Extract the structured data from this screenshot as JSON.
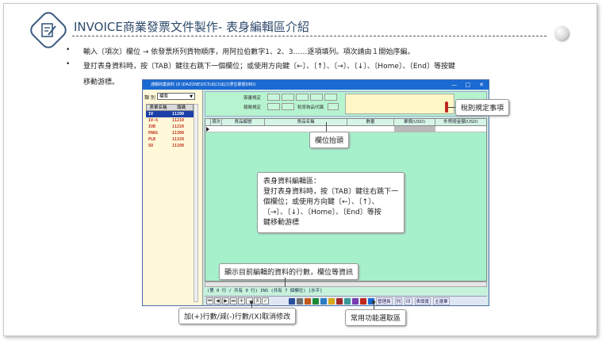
{
  "slide": {
    "title": "INVOICE商業發票文件製作- 表身編輯區介紹",
    "bullets": [
      "輸入〔項次〕欄位 → 依發票所列貨物順序，用阿拉伯數字1、2、3……逐項填列。項次請由１開始序編。",
      "登打表身資料時，按〔TAB〕鍵往右跳下一個欄位；或使用方向鍵〔←〕、〔↑〕、〔→〕、〔↓〕、〔Home〕、〔End〕等按鍵",
      "移動游標。"
    ],
    "bullet_mark": "•"
  },
  "window": {
    "title": "通關商業資料 (D:\\DAZONE\\DC5\\出口\\出口\\學生擊號DBD)",
    "controls": [
      "—",
      "□",
      "✕"
    ],
    "left_panel": {
      "category_label": "類 別",
      "category_value": "標準",
      "table_headers": [
        "表單名稱",
        "識碼"
      ],
      "rows": [
        {
          "name": "IV",
          "code": "11200",
          "selected": true
        },
        {
          "name": "IV-S",
          "code": "11210",
          "selected": false
        },
        {
          "name": "IVB",
          "code": "11220",
          "selected": false
        },
        {
          "name": "PAKG",
          "code": "11300",
          "selected": false
        },
        {
          "name": "PLB",
          "code": "11320",
          "selected": false
        },
        {
          "name": "SO",
          "code": "11100",
          "selected": false
        }
      ]
    },
    "header_form": {
      "label1": "簽審規定",
      "label2": "稽徵規定",
      "label3": "稅率物品代碼"
    },
    "grid_columns": [
      "項次",
      "貨品編號",
      "貨品名稱",
      "數量",
      "單價(USD)",
      "外幣總金額(USD)"
    ],
    "status_text": "(第 0 行 / 共有 0 行) INS (共有 7 個欄位) [水平]",
    "toolbar": {
      "plus": "+",
      "minus": "-",
      "cancel": "X",
      "words": [
        "管理員",
        "列",
        "印",
        "表頭寬",
        "主選單"
      ]
    }
  },
  "callouts": {
    "tax_rules": "稅則規定事項",
    "column_header": "欄位抬頭",
    "body_edit_title": "表身資料編輯區：",
    "body_edit_lines": [
      "登打表身資料時，按〔TAB〕鍵往右跳下一",
      "個欄位；或使用方向鍵〔←〕、〔↑〕、",
      "〔→〕、〔↓〕、〔Home〕、〔End〕等按",
      "鍵移動游標"
    ],
    "row_info": "顯示目前編輯的資料的行數，欄位等資訊",
    "add_remove": "加(+)行數/減(-)行數/(X)取消修改",
    "common_func": "常用功能選取區"
  },
  "colors": {
    "title_blue": "#2e4a6b",
    "titlebar_blue": "#1b69d2",
    "grid_green": "#a6f0cc",
    "panel_yellow": "#fff8d9",
    "accent_red": "#c0281e"
  }
}
